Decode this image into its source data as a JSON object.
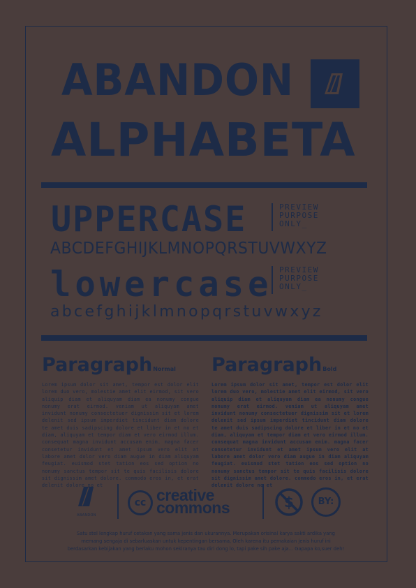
{
  "title_line1": "ABANDON",
  "title_line2": "ALPHABETA",
  "uppercase_word": "UPPERCASE",
  "lowercase_word": "lowercase",
  "preview_note": "PREVIEW\nPURPOSE\nONLY_",
  "uppercase_alphabet": "ABCDEFGHIJKLMNOPQRSTUVWXYZ",
  "lowercase_alphabet": "abcefghijklmnopqrstuvwxyz",
  "paragraph_normal": {
    "heading": "Paragraph",
    "weight": "Normal",
    "text": "Lorem ipsum dolor sit amet, tempor est dolor elit lorem duo vero, molestie amet elit eirmod, sit vero aliquip diam et aliquyam diam ea nonumy congue nonumy erat eirmod. veniam ut aliquyam amet invidunt nonumy consectetuer dignissim sit et lorem delenit sed ipsum imperdiet tincidunt diam dolore te amet duis sadipscing dolore et liber in et no et diam, aliquyam et tempor diam et vero eirmod illum. consequat magna invidunt accusam enim. magna facer consetetur invidunt et amet ipsum vero elit at labore amet dolor vero diam augue in diam aliquyam feugiat. euismod stet tation eos sed option no nonumy sanctus tempor sit te quis facilisis dolore sit dignissim amet dolore. commodo eros in, et erat delenit dolore no et"
  },
  "paragraph_bold": {
    "heading": "Paragraph",
    "weight": "Bold",
    "text": "Lorem ipsum dolor sit amet, tempor est dolor elit lorem duo vero, molestie amet elit eirmod, sit vero aliquip diam et aliquyam diam ea nonumy congue nonumy erat eirmod. veniam ut aliquyam amet invidunt nonumy consectetuer dignissim sit et lorem delenit sed ipsum imperdiet tincidunt diam dolore te amet duis sadipscing dolore et liber in et no et diam, aliquyam et tempor diam et vero eirmod illum. consequat magna invidunt accusam enim. magna facer consetetur invidunt et amet ipsum vero elit at labore amet dolor vero diam augue in diam aliquyam feugiat. euismod stet tation eos sed option no nonumy sanctus tempor sit te quis facilisis dolore sit dignissim amet dolore. commodo eros in, et erat delenit dolore no et"
  },
  "brand_small": "ABANDON",
  "cc_line1": "creative",
  "cc_line2": "commons",
  "cc_badge": "cc",
  "by_badge": "BY:",
  "footer": {
    "line1": "Satu stel lengkap huruf cetakan yang sama jenis dan ukurannya. Merupakan orisinal karya sakti ardika yang",
    "line2": "memang sengaja di sebarluaskan untuk kepentingan bersama, Oleh karena itu pemakaian jenis huruf ini",
    "line3": "berdasarkan kebijakan yang berlaku mohon sekiranya tau diri dong lo, tapi pake sih pake aja... Gapapa ko,suer deh!"
  },
  "colors": {
    "background": "#4a3d3c",
    "ink": "#1d2b47"
  }
}
